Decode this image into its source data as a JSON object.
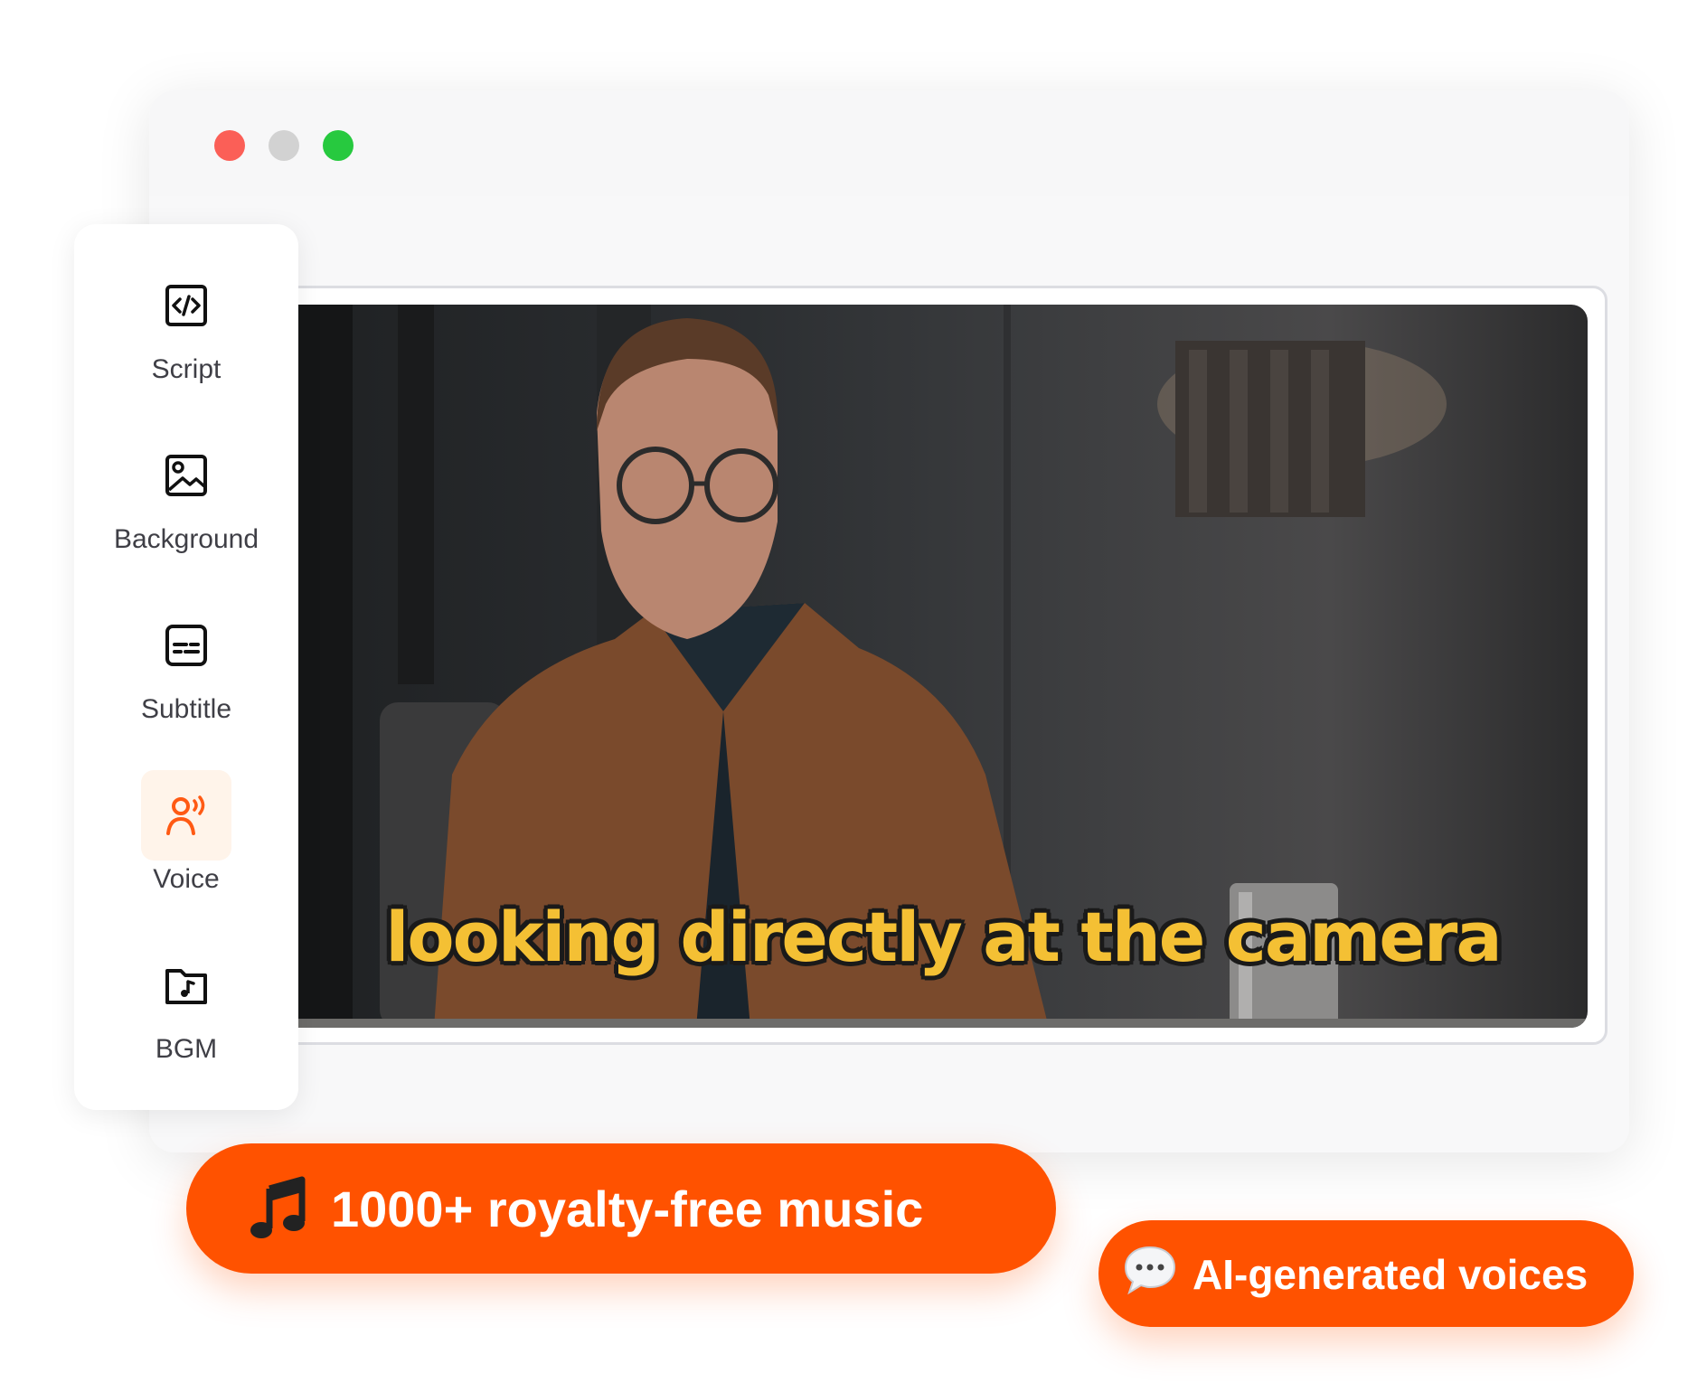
{
  "window": {
    "controls": [
      "close-dot",
      "minimize-dot",
      "maximize-dot"
    ]
  },
  "sidebar": {
    "items": [
      {
        "label": "Script",
        "icon": "code-icon",
        "active": false
      },
      {
        "label": "Background",
        "icon": "image-icon",
        "active": false
      },
      {
        "label": "Subtitle",
        "icon": "subtitle-icon",
        "active": false
      },
      {
        "label": "Voice",
        "icon": "voice-icon",
        "active": true
      },
      {
        "label": "BGM",
        "icon": "music-folder-icon",
        "active": false
      }
    ]
  },
  "preview": {
    "subtitle": "looking directly at the camera"
  },
  "badges": {
    "music": {
      "text": "1000+ royalty-free music",
      "icon": "music-note-icon"
    },
    "voices": {
      "text": "AI-generated voices",
      "icon": "speech-bubble-icon"
    }
  },
  "colors": {
    "accent": "#ff5200",
    "active_bg": "#fff4ea",
    "subtitle": "#f4c034"
  }
}
